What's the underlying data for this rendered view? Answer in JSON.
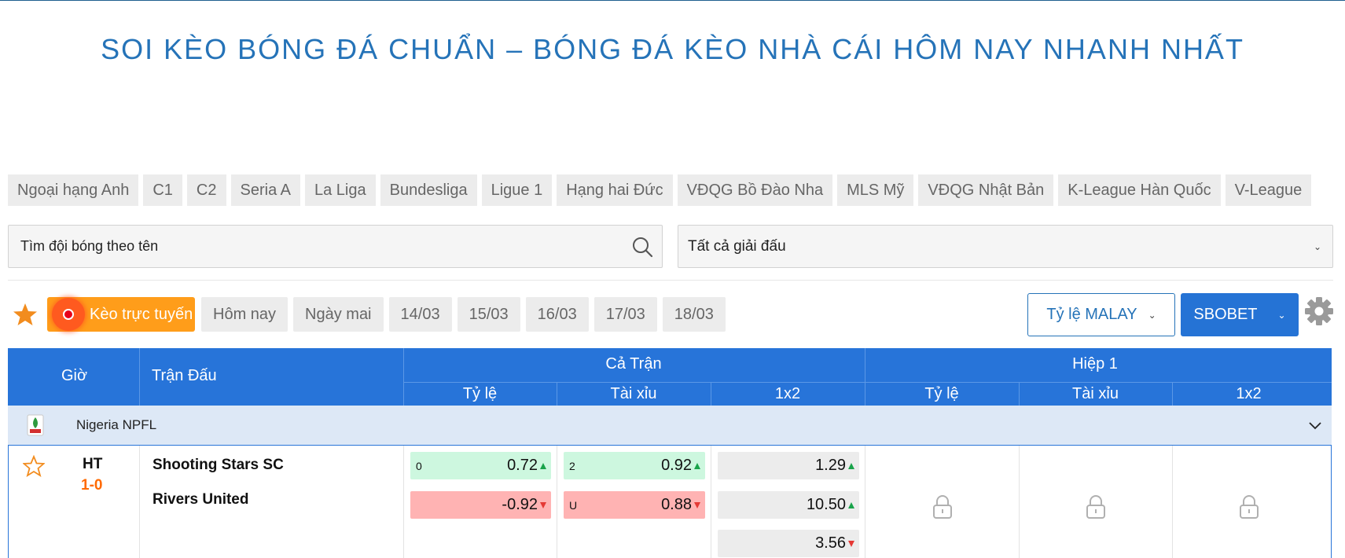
{
  "page": {
    "title": "SOI KÈO BÓNG ĐÁ CHUẨN – BÓNG ĐÁ KÈO NHÀ CÁI HÔM NAY NHANH NHẤT"
  },
  "league_tabs": [
    "Ngoại hạng Anh",
    "C1",
    "C2",
    "Seria A",
    "La Liga",
    "Bundesliga",
    "Ligue 1",
    "Hạng hai Đức",
    "VĐQG Bồ Đào Nha",
    "MLS Mỹ",
    "VĐQG Nhật Bản",
    "K-League Hàn Quốc",
    "V-League"
  ],
  "search": {
    "placeholder": "Tìm đội bóng theo tên"
  },
  "league_select": {
    "selected": "Tất cả giải đấu"
  },
  "filters": {
    "live_label": "Kèo trực tuyến",
    "days": [
      "Hôm nay",
      "Ngày mai",
      "14/03",
      "15/03",
      "16/03",
      "17/03",
      "18/03"
    ]
  },
  "controls": {
    "odds_type": "Tỷ lệ MALAY",
    "bookmaker": "SBOBET"
  },
  "table": {
    "headers": {
      "time": "Giờ",
      "match": "Trận Đấu",
      "full_match": "Cả Trận",
      "first_half": "Hiệp 1",
      "handicap": "Tỷ lệ",
      "over_under": "Tài xỉu",
      "one_x_two": "1x2"
    },
    "league": {
      "name": "Nigeria NPFL"
    },
    "match": {
      "status": "HT",
      "score": "1-0",
      "home": "Shooting Stars SC",
      "away": "Rivers United",
      "handicap": {
        "line": "0",
        "home_odds": "0.72",
        "away_odds": "-0.92"
      },
      "over_under": {
        "line": "2",
        "over_odds": "0.92",
        "under_label": "U",
        "under_odds": "0.88"
      },
      "one_x_two": {
        "home": "1.29",
        "away": "10.50",
        "draw": "3.56"
      }
    }
  },
  "colors": {
    "title": "#2573b8",
    "header_bg": "#2774d9",
    "live_orange": "#ff9d1a",
    "score_orange": "#ff6a00",
    "odds_up_green": "#19a34a",
    "odds_down_red": "#e53935"
  }
}
